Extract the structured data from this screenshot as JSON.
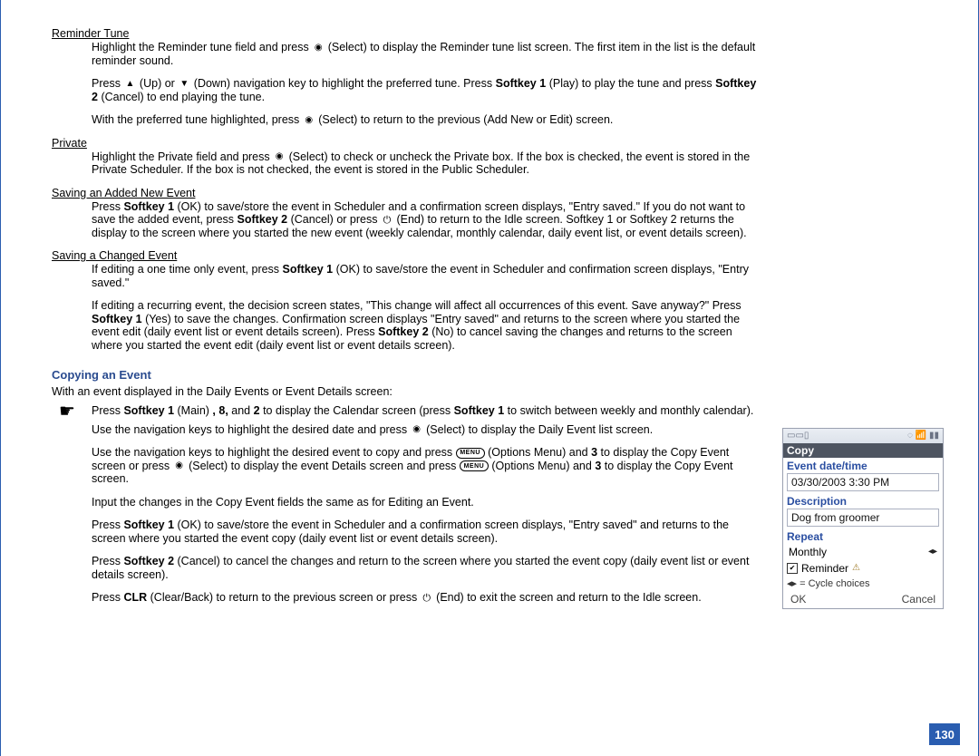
{
  "page_number": "130",
  "sections": {
    "reminder_tune": {
      "label": "Reminder Tune",
      "p1_a": "Highlight the Reminder tune field and press ",
      "p1_b": " (Select) to display the Reminder tune list screen. The first item in the list is the default reminder sound.",
      "p2_a": "Press ",
      "p2_b": " (Up) or ",
      "p2_c": " (Down) navigation key to highlight the preferred tune. Press ",
      "p2_sk1": "Softkey 1",
      "p2_d": " (Play) to play the tune and press ",
      "p2_sk2": "Softkey 2",
      "p2_e": " (Cancel) to end playing the tune.",
      "p3_a": "With the preferred tune highlighted, press ",
      "p3_b": " (Select) to return to the previous (Add New or Edit) screen."
    },
    "private": {
      "label": "Private",
      "p1_a": "Highlight the Private field and press ",
      "p1_b": " (Select) to check or uncheck the Private box. If the box is checked, the event is stored in the Private Scheduler. If the box is not checked, the event is stored in the Public Scheduler."
    },
    "save_new": {
      "label": "Saving an Added New Event",
      "p1_a": "Press ",
      "p1_sk1": "Softkey 1",
      "p1_b": " (OK) to save/store the event in Scheduler and a confirmation screen displays, \"Entry saved.\" If you do not want to save the added event, press ",
      "p1_sk2": "Softkey 2",
      "p1_c": " (Cancel) or press ",
      "p1_d": " (End) to return to the Idle screen. Softkey 1 or Softkey 2 returns the display to the screen where you started the new event (weekly calendar, monthly calendar, daily event list, or event details screen)."
    },
    "save_edit": {
      "label": "Saving a Changed Event",
      "p1_a": "If editing a one time only event, press ",
      "p1_sk1": "Softkey 1",
      "p1_b": " (OK) to save/store the event in Scheduler and confirmation screen displays, \"Entry saved.\"",
      "p2_a": "If editing a recurring event, the decision screen states, \"This change will affect all occurrences of this event. Save anyway?\" Press ",
      "p2_sk1": "Softkey 1",
      "p2_b": " (Yes) to save the changes. Confirmation screen displays \"Entry saved\" and returns to the screen where you started the event edit (daily event list or event details screen). Press ",
      "p2_sk2": "Softkey 2",
      "p2_c": " (No) to cancel saving the changes and returns to the screen where you started the event edit (daily event list or event details screen)."
    }
  },
  "copying": {
    "heading": "Copying an Event",
    "intro": "With an event displayed in the Daily Events or Event Details screen:",
    "b1_a": "Press ",
    "b1_sk1": "Softkey 1",
    "b1_b": " (Main)",
    "b1_c": ", 8,",
    "b1_d": " and ",
    "b1_e": "2",
    "b1_f": " to display the Calendar screen (press ",
    "b1_g": " to switch between weekly and monthly calendar).",
    "b2_a": "Use the navigation keys to highlight the desired date and press ",
    "b2_b": " (Select) to display the Daily Event list screen.",
    "b3_a": "Use the navigation keys to highlight the desired event to copy and press ",
    "b3_b": " (Options Menu) and ",
    "b3_c": "3",
    "b3_d": " to display the Copy Event screen or press ",
    "b3_e": " (Select) to display the event Details screen and press ",
    "b3_f": " (Options Menu) and ",
    "b3_g": "3",
    "b3_h": " to display the Copy Event screen.",
    "b4": "Input the changes in the Copy Event fields the same as for Editing an Event.",
    "b5_a": "Press ",
    "b5_sk1": "Softkey 1",
    "b5_b": " (OK) to save/store the event in Scheduler and a confirmation screen displays, \"Entry saved\" and returns to the screen where you started the event copy (daily event list or event details screen).",
    "b6_a": "Press ",
    "b6_sk2": "Softkey 2",
    "b6_b": " (Cancel) to cancel the changes and return to the screen where you started the event copy (daily event list or event details screen).",
    "b7_a": "Press ",
    "b7_clr": "CLR",
    "b7_b": " (Clear/Back) to return to the previous screen or press ",
    "b7_c": " (End) to exit the screen and return to the Idle screen."
  },
  "phone": {
    "title": "Copy",
    "event_dt_label": "Event date/time",
    "event_dt_value": "03/30/2003 3:30 PM",
    "desc_label": "Description",
    "desc_value": "Dog from groomer",
    "repeat_label": "Repeat",
    "repeat_value": "Monthly",
    "reminder_label": "Reminder",
    "cycle_note": "◂▸ = Cycle choices",
    "ok": "OK",
    "cancel": "Cancel"
  }
}
